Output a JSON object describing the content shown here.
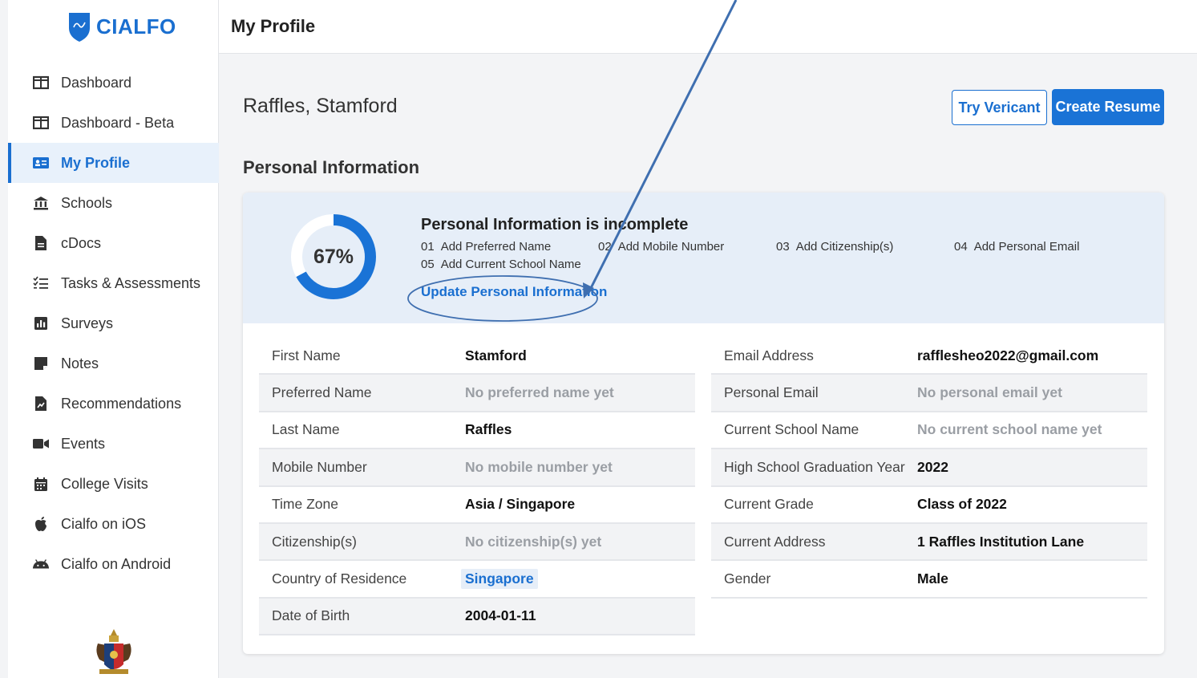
{
  "brand": {
    "name": "CIALFO",
    "color": "#1a6fd0"
  },
  "sidebar": {
    "items": [
      {
        "label": "Dashboard",
        "icon": "dashboard-icon",
        "active": false
      },
      {
        "label": "Dashboard - Beta",
        "icon": "dashboard-beta-icon",
        "active": false
      },
      {
        "label": "My Profile",
        "icon": "profile-card-icon",
        "active": true
      },
      {
        "label": "Schools",
        "icon": "bank-icon",
        "active": false
      },
      {
        "label": "cDocs",
        "icon": "document-icon",
        "active": false
      },
      {
        "label": "Tasks & Assessments",
        "icon": "checklist-icon",
        "active": false
      },
      {
        "label": "Surveys",
        "icon": "bar-chart-icon",
        "active": false
      },
      {
        "label": "Notes",
        "icon": "note-icon",
        "active": false
      },
      {
        "label": "Recommendations",
        "icon": "recommendation-icon",
        "active": false
      },
      {
        "label": "Events",
        "icon": "video-camera-icon",
        "active": false
      },
      {
        "label": "College Visits",
        "icon": "calendar-icon",
        "active": false
      },
      {
        "label": "Cialfo on iOS",
        "icon": "apple-icon",
        "active": false
      },
      {
        "label": "Cialfo on Android",
        "icon": "android-icon",
        "active": false
      }
    ]
  },
  "header": {
    "title": "My Profile"
  },
  "main": {
    "student_name": "Raffles, Stamford",
    "try_button": "Try Vericant",
    "create_button": "Create Resume",
    "section_title": "Personal Information"
  },
  "completion": {
    "percent": 67,
    "percent_label": "67%",
    "title": "Personal Information is incomplete",
    "todos": [
      {
        "num": "01",
        "label": "Add Preferred Name"
      },
      {
        "num": "02",
        "label": "Add Mobile Number"
      },
      {
        "num": "03",
        "label": "Add Citizenship(s)"
      },
      {
        "num": "04",
        "label": "Add Personal Email"
      },
      {
        "num": "05",
        "label": "Add Current School Name"
      }
    ],
    "update_link": "Update Personal Information"
  },
  "details_left": [
    {
      "label": "First Name",
      "value": "Stamford",
      "state": "filled"
    },
    {
      "label": "Preferred Name",
      "value": "No preferred name yet",
      "state": "empty"
    },
    {
      "label": "Last Name",
      "value": "Raffles",
      "state": "filled"
    },
    {
      "label": "Mobile Number",
      "value": "No mobile number yet",
      "state": "empty"
    },
    {
      "label": "Time Zone",
      "value": "Asia / Singapore",
      "state": "filled"
    },
    {
      "label": "Citizenship(s)",
      "value": "No citizenship(s) yet",
      "state": "empty"
    },
    {
      "label": "Country of Residence",
      "value": "Singapore",
      "state": "link"
    },
    {
      "label": "Date of Birth",
      "value": "2004-01-11",
      "state": "filled"
    }
  ],
  "details_right": [
    {
      "label": "Email Address",
      "value": "rafflesheo2022@gmail.com",
      "state": "filled"
    },
    {
      "label": "Personal Email",
      "value": "No personal email yet",
      "state": "empty"
    },
    {
      "label": "Current School Name",
      "value": "No current school name yet",
      "state": "empty"
    },
    {
      "label": "High School Graduation Year",
      "value": "2022",
      "state": "filled"
    },
    {
      "label": "Current Grade",
      "value": "Class of 2022",
      "state": "filled"
    },
    {
      "label": "Current Address",
      "value": "1 Raffles Institution Lane",
      "state": "filled"
    },
    {
      "label": "Gender",
      "value": "Male",
      "state": "filled"
    }
  ]
}
